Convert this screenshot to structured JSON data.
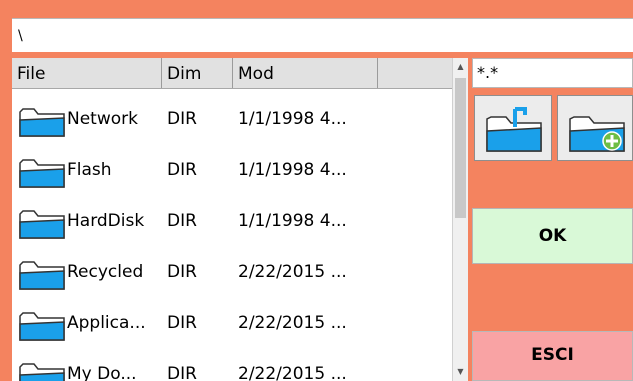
{
  "path": {
    "value": "\\"
  },
  "file_list": {
    "columns": [
      "File",
      "Dim",
      "Mod",
      ""
    ],
    "rows": [
      {
        "name": "Network",
        "dim": "DIR",
        "mod": "1/1/1998 4...",
        "icon": "folder-icon"
      },
      {
        "name": "Flash",
        "dim": "DIR",
        "mod": "1/1/1998 4...",
        "icon": "folder-icon"
      },
      {
        "name": "HardDisk",
        "dim": "DIR",
        "mod": "1/1/1998 4...",
        "icon": "folder-icon"
      },
      {
        "name": "Recycled",
        "dim": "DIR",
        "mod": "2/22/2015 ...",
        "icon": "folder-icon"
      },
      {
        "name": "Applica...",
        "dim": "DIR",
        "mod": "2/22/2015 ...",
        "icon": "folder-icon"
      },
      {
        "name": "My Do...",
        "dim": "DIR",
        "mod": "2/22/2015 ...",
        "icon": "folder-icon"
      }
    ]
  },
  "filter": {
    "value": "*.*"
  },
  "toolbar": {
    "up_icon": "folder-up-icon",
    "new_icon": "new-folder-icon"
  },
  "buttons": {
    "ok": "OK",
    "cancel": "ESCI"
  },
  "colors": {
    "background": "#f4835f",
    "ok": "#d9f9d7",
    "cancel": "#f9a3a4",
    "folder": "#1aa0ea"
  }
}
